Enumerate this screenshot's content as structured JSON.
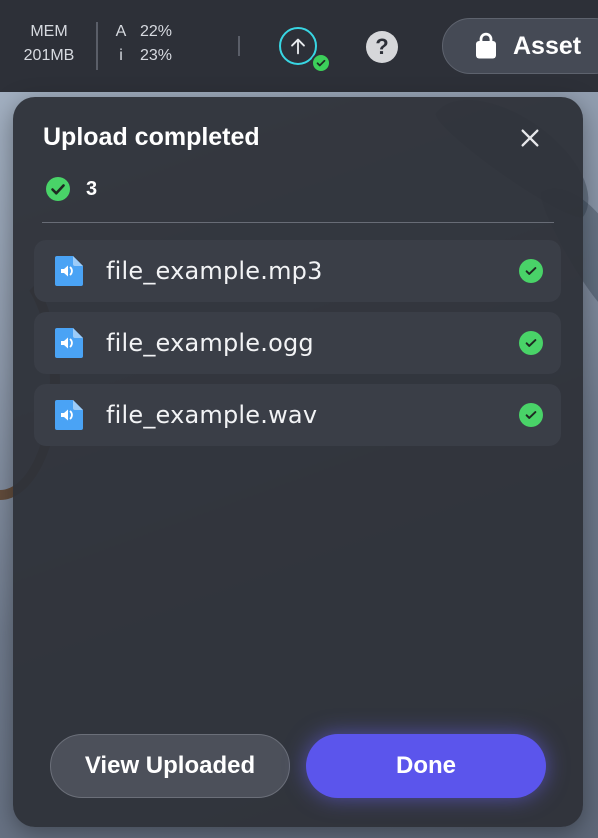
{
  "toolbar": {
    "mem_label": "MEM",
    "mem_value": "201MB",
    "a_label": "A",
    "a_value": "22%",
    "i_label": "i",
    "i_value": "23%",
    "help_label": "?",
    "asset_label": "Asset"
  },
  "dialog": {
    "title": "Upload completed",
    "completed_count": "3",
    "files": [
      {
        "name": "file_example.mp3",
        "icon": "audio-file-icon",
        "status": "complete"
      },
      {
        "name": "file_example.ogg",
        "icon": "audio-file-icon",
        "status": "complete"
      },
      {
        "name": "file_example.wav",
        "icon": "audio-file-icon",
        "status": "complete"
      }
    ],
    "view_uploaded_label": "View Uploaded",
    "done_label": "Done"
  },
  "colors": {
    "accent": "#5b55ec",
    "success": "#49d368",
    "upload_ring": "#38d6e3",
    "file_icon": "#4aa3f5"
  }
}
